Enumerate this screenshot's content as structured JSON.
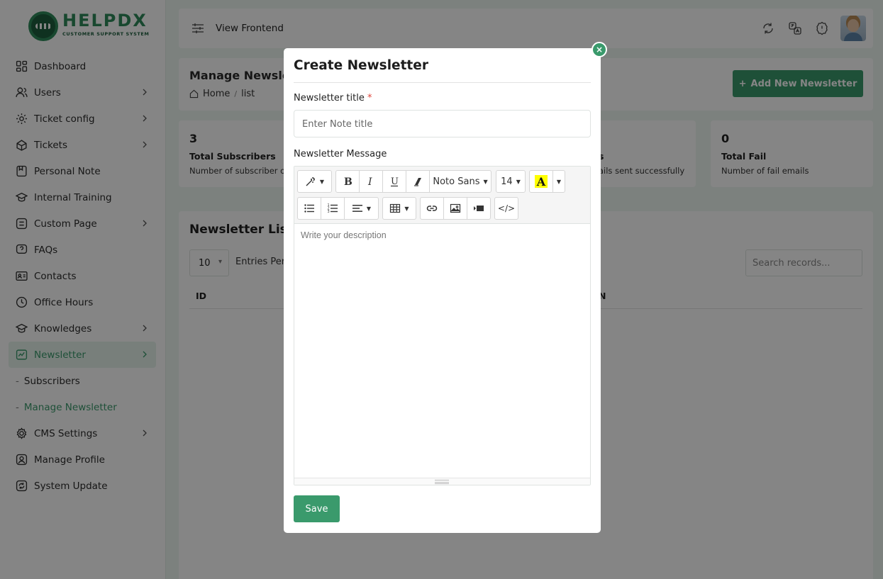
{
  "brand": {
    "name": "HELPDX",
    "tagline": "CUSTOMER SUPPORT SYSTEM"
  },
  "sidebar": {
    "items": [
      {
        "label": "Dashboard",
        "icon": "dashboard-icon"
      },
      {
        "label": "Users",
        "icon": "users-icon"
      },
      {
        "label": "Ticket config",
        "icon": "ticket-config-icon"
      },
      {
        "label": "Tickets",
        "icon": "tickets-icon"
      },
      {
        "label": "Personal Note",
        "icon": "note-icon"
      },
      {
        "label": "Internal Training",
        "icon": "training-icon"
      },
      {
        "label": "Custom Page",
        "icon": "custom-page-icon"
      },
      {
        "label": "FAQs",
        "icon": "faq-icon"
      },
      {
        "label": "Contacts",
        "icon": "contacts-icon"
      },
      {
        "label": "Office Hours",
        "icon": "clock-icon"
      },
      {
        "label": "Knowledges",
        "icon": "knowledge-icon"
      },
      {
        "label": "Newsletter",
        "icon": "newsletter-icon"
      },
      {
        "label": "Subscribers"
      },
      {
        "label": "Manage Newsletter"
      },
      {
        "label": "CMS Settings",
        "icon": "cms-settings-icon"
      },
      {
        "label": "Manage Profile",
        "icon": "profile-icon"
      },
      {
        "label": "System Update",
        "icon": "system-update-icon"
      }
    ]
  },
  "topbar": {
    "view_frontend": "View Frontend"
  },
  "header": {
    "title": "Manage Newsletter",
    "breadcrumb": {
      "home": "Home",
      "sep": "/",
      "current": "list"
    },
    "add_button": "Add New Newsletter"
  },
  "stats": [
    {
      "value": "3",
      "label": "Total Subscribers",
      "desc": "Number of subscriber on"
    },
    {
      "label": "s",
      "desc": "ails sent successfully"
    },
    {
      "value": "0",
      "label": "Total Fail",
      "desc": "Number of fail emails"
    }
  ],
  "list": {
    "title": "Newsletter List",
    "per_page": "10",
    "entries_label": "Entries Per",
    "search_placeholder": "Search records...",
    "columns": [
      "ID",
      "N"
    ]
  },
  "modal": {
    "title": "Create Newsletter",
    "close": "×",
    "title_label": "Newsletter title",
    "required_mark": "*",
    "title_placeholder": "Enter Note title",
    "message_label": "Newsletter Message",
    "font_name": "Noto Sans",
    "font_size": "14",
    "color_letter": "A",
    "code_label": "</>",
    "editor_placeholder": "Write your description",
    "save": "Save"
  },
  "colors": {
    "accent": "#3a9a6c",
    "background": "#eef7f2",
    "highlight": "#ffff00"
  }
}
